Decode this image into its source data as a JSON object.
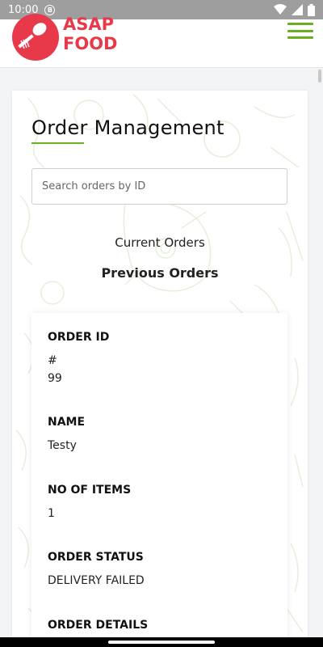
{
  "status_bar": {
    "time": "10:00",
    "notification_badge": "B"
  },
  "header": {
    "brand_line1": "ASAP",
    "brand_line2": "FOOD",
    "brand_color": "#e8394a",
    "accent_color": "#6ab023"
  },
  "page": {
    "title": "Order Management",
    "search_placeholder": "Search orders by ID",
    "tabs": [
      {
        "label": "Current Orders",
        "active": false
      },
      {
        "label": "Previous Orders",
        "active": true
      }
    ]
  },
  "order": {
    "id_label": "ORDER ID",
    "id_prefix": "#",
    "id_value": "99",
    "name_label": "NAME",
    "name_value": "Testy",
    "items_label": "NO OF ITEMS",
    "items_value": "1",
    "status_label": "ORDER STATUS",
    "status_value": "DELIVERY FAILED",
    "details_label": "ORDER DETAILS"
  }
}
